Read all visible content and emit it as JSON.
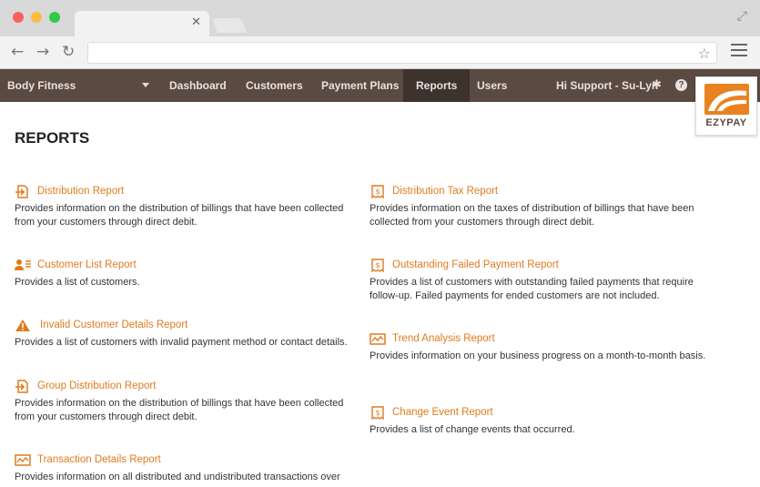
{
  "browser": {
    "url": ""
  },
  "nav": {
    "business": "Body Fitness",
    "items": [
      "Dashboard",
      "Customers",
      "Payment Plans",
      "Reports",
      "Users"
    ],
    "active": "Reports",
    "user": "Hi Support - Su-Lyn"
  },
  "logo": {
    "text": "EZYPAY"
  },
  "page": {
    "title": "REPORTS"
  },
  "reports_left": [
    {
      "title": "Distribution Report",
      "desc": "Provides information on the distribution of billings that have been collected from your customers through direct debit.",
      "icon": "document-arrow-icon"
    },
    {
      "title": "Customer List Report",
      "desc": "Provides a list of customers.",
      "icon": "user-list-icon"
    },
    {
      "title": "Invalid Customer Details Report",
      "desc": "Provides a list of customers with invalid payment method or contact details.",
      "icon": "warning-icon"
    },
    {
      "title": "Group Distribution Report",
      "desc": "Provides information on the distribution of billings that have been collected from your customers through direct debit.",
      "icon": "document-arrow-icon"
    },
    {
      "title": "Transaction Details Report",
      "desc": "Provides information on all distributed and undistributed transactions over",
      "icon": "trend-chart-icon"
    }
  ],
  "reports_right": [
    {
      "title": "Distribution Tax Report",
      "desc": "Provides information on the taxes of distribution of billings that have been collected from your customers through direct debit.",
      "icon": "receipt-icon"
    },
    {
      "title": "Outstanding Failed Payment Report",
      "desc": "Provides a list of customers with outstanding failed payments that require follow-up. Failed payments for ended customers are not included.",
      "icon": "receipt-icon"
    },
    {
      "title": "Trend Analysis Report",
      "desc": "Provides information on your business progress on a month-to-month basis.",
      "icon": "trend-chart-icon"
    },
    {
      "title": "Change Event Report",
      "desc": "Provides a list of change events that occurred.",
      "icon": "receipt-icon"
    }
  ],
  "colors": {
    "accent": "#e07b1f",
    "nav_bg": "#5a4a42",
    "nav_active": "#3e322d"
  }
}
